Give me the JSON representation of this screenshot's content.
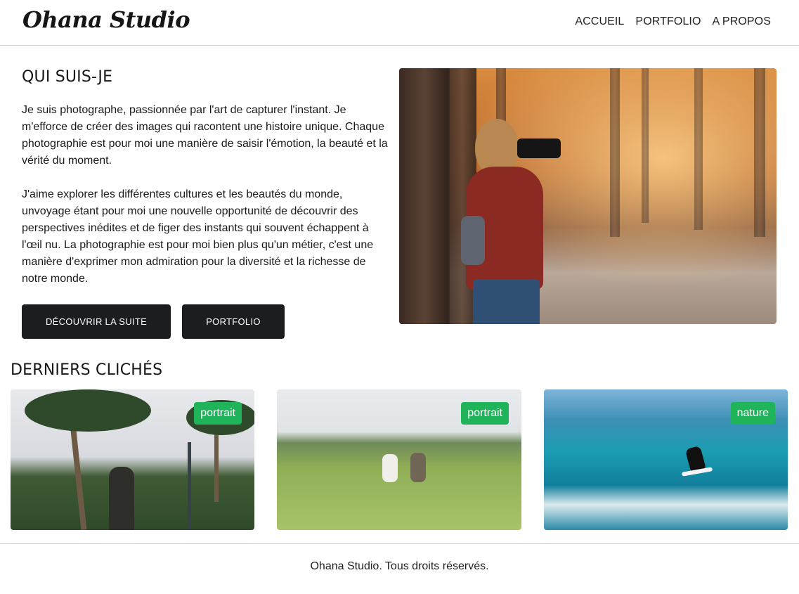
{
  "header": {
    "logo": "Ohana Studio",
    "nav": [
      {
        "label": "ACCUEIL"
      },
      {
        "label": "PORTFOLIO"
      },
      {
        "label": "A PROPOS"
      }
    ]
  },
  "about": {
    "title": "QUI SUIS-JE",
    "paragraphs": [
      "Je suis photographe, passionnée par l'art de capturer l'instant. Je m'efforce de créer des images qui racontent une histoire unique. Chaque photographie est pour moi une manière de saisir l'émotion, la beauté et la vérité du moment.",
      "J'aime explorer les différentes cultures et les beautés du monde, unvoyage étant pour moi une nouvelle opportunité de découvrir des perspectives inédites et de figer des instants qui souvent échappent à l'œil nu. La photographie est pour moi bien plus qu'un métier, c'est une manière d'exprimer mon admiration pour la diversité et la richesse de notre monde."
    ],
    "buttons": {
      "discover": "DÉCOUVRIR LA SUITE",
      "portfolio": "PORTFOLIO"
    }
  },
  "latest": {
    "title": "DERNIERS CLICHÉS",
    "cards": [
      {
        "tag": "portrait"
      },
      {
        "tag": "portrait"
      },
      {
        "tag": "nature"
      }
    ]
  },
  "footer": {
    "text": "Ohana Studio. Tous droits réservés."
  },
  "colors": {
    "button_bg": "#1c1d1f",
    "badge_bg": "#1fb35a",
    "border": "#cfcfcf"
  }
}
